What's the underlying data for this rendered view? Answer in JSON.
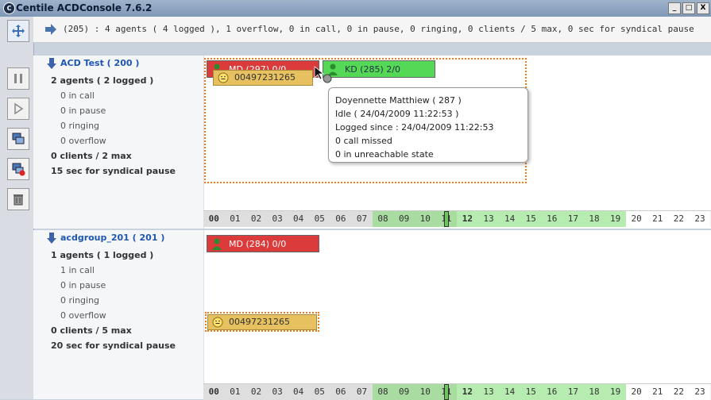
{
  "window": {
    "title": "Centile ACDConsole 7.6.2",
    "controls": [
      "_",
      "□",
      "X"
    ]
  },
  "summary": "(205) : 4 agents ( 4 logged ), 1 overflow, 0 in call, 0 in pause, 0 ringing, 0 clients / 5 max, 0 sec for syndical pause",
  "groups": [
    {
      "name": "ACD Test ( 200 )",
      "agents": "2 agents ( 2 logged )",
      "in_call": "0 in call",
      "in_pause": "0 in pause",
      "ringing": "0 ringing",
      "overflow": "0 overflow",
      "clients": "0 clients / 2 max",
      "syndical": "15 sec for syndical pause",
      "agent_boxes": [
        {
          "label": "MD (297)  0/0",
          "status": "red"
        },
        {
          "label": "KD (285)  2/0",
          "status": "green"
        }
      ],
      "call": "00497231265"
    },
    {
      "name": "acdgroup_201 ( 201 )",
      "agents": "1 agents ( 1 logged )",
      "in_call": "1 in call",
      "in_pause": "0 in pause",
      "ringing": "0 ringing",
      "overflow": "0 overflow",
      "clients": "0 clients / 5 max",
      "syndical": "20 sec for syndical pause",
      "agent_boxes": [
        {
          "label": "MD (284)  0/0",
          "status": "red"
        }
      ],
      "call": "00497231265"
    }
  ],
  "tooltip": {
    "name": "Doyennette Matthiew ( 287 )",
    "idle": "Idle ( 24/04/2009 11:22:53 )",
    "logged": "Logged since : 24/04/2009 11:22:53",
    "missed": "0 call missed",
    "unreachable": "0  in unreachable state"
  },
  "timeline_hours": [
    "00",
    "01",
    "02",
    "03",
    "04",
    "05",
    "06",
    "07",
    "08",
    "09",
    "10",
    "11",
    "12",
    "13",
    "14",
    "15",
    "16",
    "17",
    "18",
    "19",
    "20",
    "21",
    "22",
    "23"
  ],
  "colors": {
    "accent_orange": "#ef7a1a",
    "agent_red": "#dc3b3b",
    "agent_green": "#55d855",
    "call_gold": "#e7c160"
  }
}
